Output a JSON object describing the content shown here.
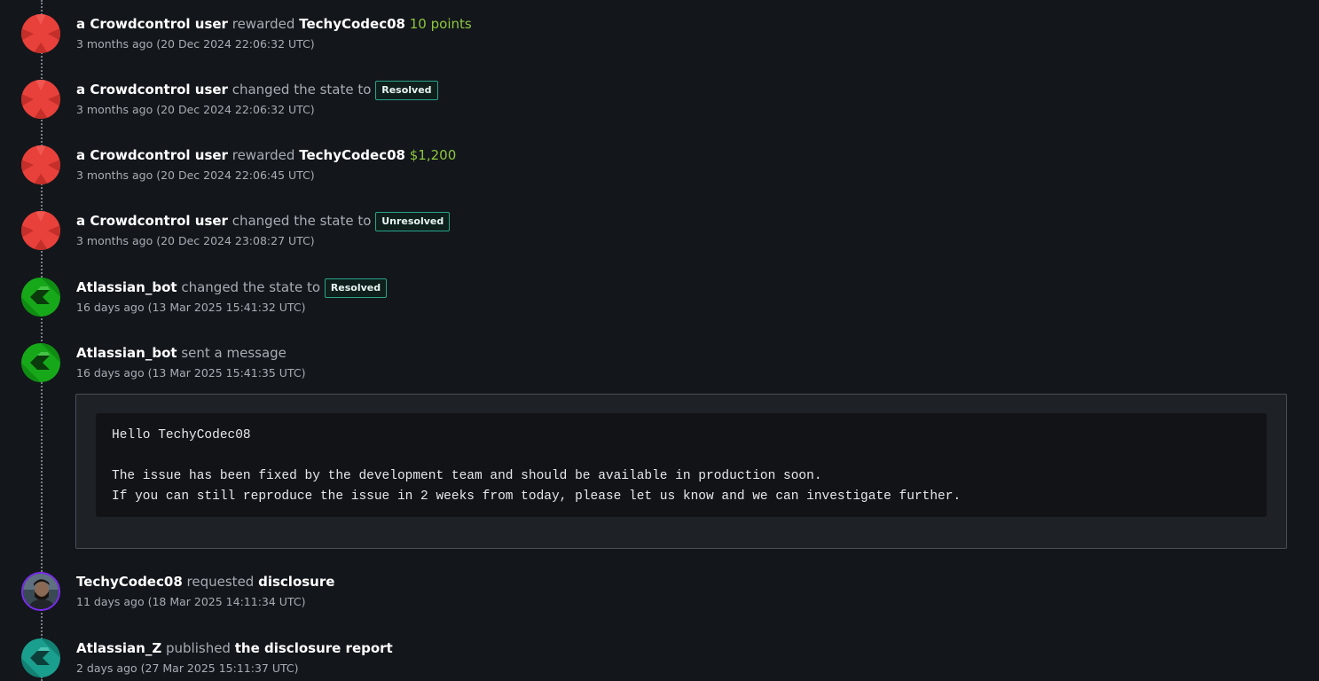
{
  "entries": [
    {
      "actor": "a Crowdcontrol user",
      "verb": "rewarded",
      "target": "TechyCodec08",
      "reward": "10 points",
      "time": "3 months ago (20 Dec 2024 22:06:32 UTC)",
      "avatar": "crowdcontrol-red"
    },
    {
      "actor": "a Crowdcontrol user",
      "verb": "changed the state to",
      "badge": "Resolved",
      "time": "3 months ago (20 Dec 2024 22:06:32 UTC)",
      "avatar": "crowdcontrol-red"
    },
    {
      "actor": "a Crowdcontrol user",
      "verb": "rewarded",
      "target": "TechyCodec08",
      "reward": "$1,200",
      "time": "3 months ago (20 Dec 2024 22:06:45 UTC)",
      "avatar": "crowdcontrol-red"
    },
    {
      "actor": "a Crowdcontrol user",
      "verb": "changed the state to",
      "badge": "Unresolved",
      "time": "3 months ago (20 Dec 2024 23:08:27 UTC)",
      "avatar": "crowdcontrol-red"
    },
    {
      "actor": "Atlassian_bot",
      "verb": "changed the state to",
      "badge": "Resolved",
      "time": "16 days ago (13 Mar 2025 15:41:32 UTC)",
      "avatar": "atlassian-green"
    },
    {
      "actor": "Atlassian_bot",
      "verb": "sent a message",
      "time": "16 days ago (13 Mar 2025 15:41:35 UTC)",
      "avatar": "atlassian-green",
      "message": "Hello TechyCodec08\n\nThe issue has been fixed by the development team and should be available in production soon.\nIf you can still reproduce the issue in 2 weeks from today, please let us know and we can investigate further."
    },
    {
      "actor": "TechyCodec08",
      "verb": "requested",
      "target": "disclosure",
      "time": "11 days ago (18 Mar 2025 14:11:34 UTC)",
      "avatar": "user-photo"
    },
    {
      "actor": "Atlassian_Z",
      "verb": "published",
      "target": "the disclosure report",
      "time": "2 days ago (27 Mar 2025 15:11:37 UTC)",
      "avatar": "atlassian-teal"
    }
  ],
  "colors": {
    "background": "#13161b",
    "reward": "#8dc63f",
    "badge_border": "#2aa58a"
  }
}
